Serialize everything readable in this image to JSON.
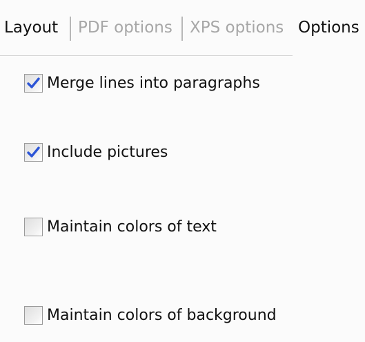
{
  "tabs": [
    {
      "label": "Layout",
      "active": true
    },
    {
      "label": "PDF options",
      "active": false
    },
    {
      "label": "XPS options",
      "active": false
    },
    {
      "label": "Options",
      "active": true
    }
  ],
  "options": [
    {
      "label": "Merge lines into paragraphs",
      "checked": true
    },
    {
      "label": "Include pictures",
      "checked": true
    },
    {
      "label": "Maintain colors of text",
      "checked": false
    },
    {
      "label": "Maintain colors of background",
      "checked": false
    }
  ],
  "colors": {
    "check_mark": "#2c55d6",
    "inactive_tab_text": "#a7a7a7",
    "background": "#fbfbfb"
  },
  "icons": {
    "checkmark": "check-icon"
  }
}
